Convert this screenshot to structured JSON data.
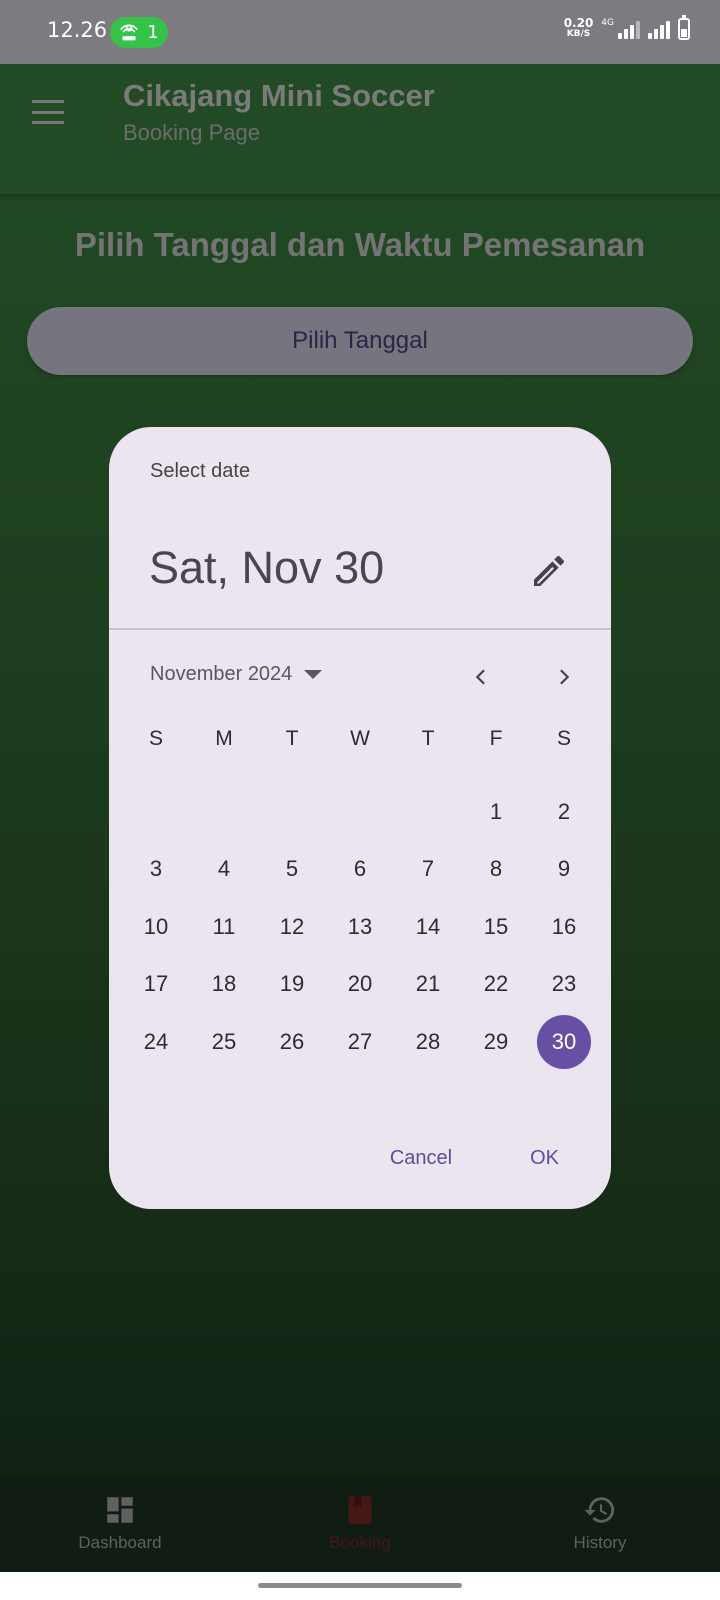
{
  "status_bar": {
    "time": "12.26",
    "hotspot_count": "1",
    "speed_value": "0.20",
    "speed_unit": "KB/S",
    "network_type": "4G"
  },
  "app_bar": {
    "title": "Cikajang Mini Soccer",
    "subtitle": "Booking Page"
  },
  "page": {
    "heading": "Pilih Tanggal dan Waktu Pemesanan",
    "pick_date_button": "Pilih Tanggal"
  },
  "date_picker": {
    "label": "Select date",
    "selected_display": "Sat, Nov 30",
    "month_label": "November 2024",
    "weekdays": [
      "S",
      "M",
      "T",
      "W",
      "T",
      "F",
      "S"
    ],
    "weeks": [
      [
        "",
        "",
        "",
        "",
        "",
        "1",
        "2"
      ],
      [
        "3",
        "4",
        "5",
        "6",
        "7",
        "8",
        "9"
      ],
      [
        "10",
        "11",
        "12",
        "13",
        "14",
        "15",
        "16"
      ],
      [
        "17",
        "18",
        "19",
        "20",
        "21",
        "22",
        "23"
      ],
      [
        "24",
        "25",
        "26",
        "27",
        "28",
        "29",
        "30"
      ]
    ],
    "selected_day": "30",
    "cancel_label": "Cancel",
    "ok_label": "OK",
    "accent_color": "#6750a4"
  },
  "bottom_nav": {
    "items": [
      {
        "label": "Dashboard",
        "icon": "dashboard-icon"
      },
      {
        "label": "Booking",
        "icon": "book-icon"
      },
      {
        "label": "History",
        "icon": "history-icon"
      }
    ],
    "active_index": 1,
    "active_color": "#6f1b14"
  }
}
